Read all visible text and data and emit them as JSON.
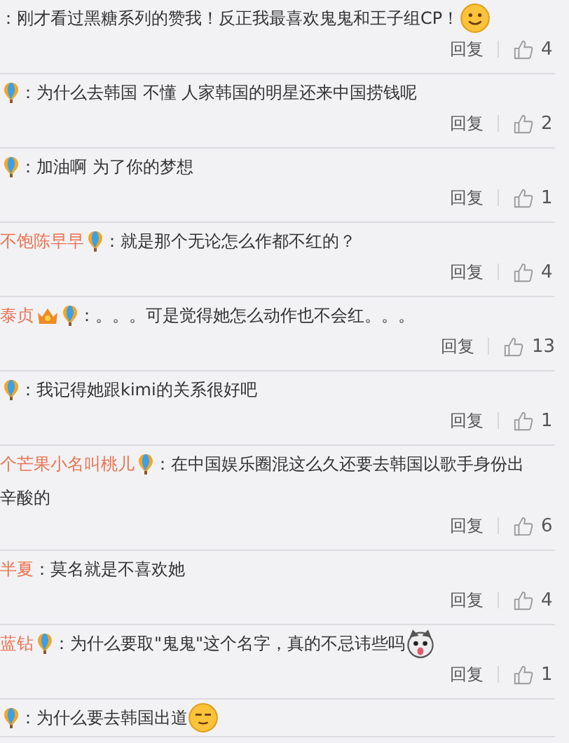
{
  "comments": [
    {
      "text": "：刚才看过黑糖系列的赞我！反正我最喜欢鬼鬼和王子组CP！",
      "emoji": {
        "kind": "smile"
      },
      "reply": "回复",
      "likes": "4"
    },
    {
      "badges": [
        {
          "kind": "balloon"
        }
      ],
      "text": "：为什么去韩国   不懂   人家韩国的明星还来中国捞钱呢",
      "reply": "回复",
      "likes": "2"
    },
    {
      "badges": [
        {
          "kind": "balloon"
        }
      ],
      "text": "：加油啊 为了你的梦想",
      "reply": "回复",
      "likes": "1"
    },
    {
      "user": "不饱陈早早",
      "badges": [
        {
          "kind": "balloon"
        }
      ],
      "text": "：就是那个无论怎么作都不红的？",
      "reply": "回复",
      "likes": "4"
    },
    {
      "user": "泰贞",
      "badges": [
        {
          "kind": "crown"
        },
        {
          "kind": "balloon"
        }
      ],
      "text": "：。。。可是觉得她怎么动作也不会红。。。",
      "reply": "回复",
      "likes": "13"
    },
    {
      "badges": [
        {
          "kind": "balloon"
        }
      ],
      "text": "：我记得她跟kimi的关系很好吧",
      "reply": "回复",
      "likes": "1"
    },
    {
      "user": "个芒果小名叫桃儿",
      "badges": [
        {
          "kind": "balloon"
        }
      ],
      "text": "：在中国娱乐圈混这么久还要去韩国以歌手身份出",
      "continuation": "辛酸的",
      "reply": "回复",
      "likes": "6"
    },
    {
      "user": "半夏",
      "text": "：莫名就是不喜欢她",
      "reply": "回复",
      "likes": "4"
    },
    {
      "user": "蓝钻",
      "badges": [
        {
          "kind": "balloon"
        }
      ],
      "text": "：为什么要取\"鬼鬼\"这个名字，真的不忌讳些吗",
      "emoji": {
        "kind": "dog"
      },
      "reply": "回复",
      "likes": "1"
    },
    {
      "badges": [
        {
          "kind": "balloon"
        }
      ],
      "text": "：为什么要去韩国出道",
      "emoji": {
        "kind": "meh"
      }
    }
  ]
}
